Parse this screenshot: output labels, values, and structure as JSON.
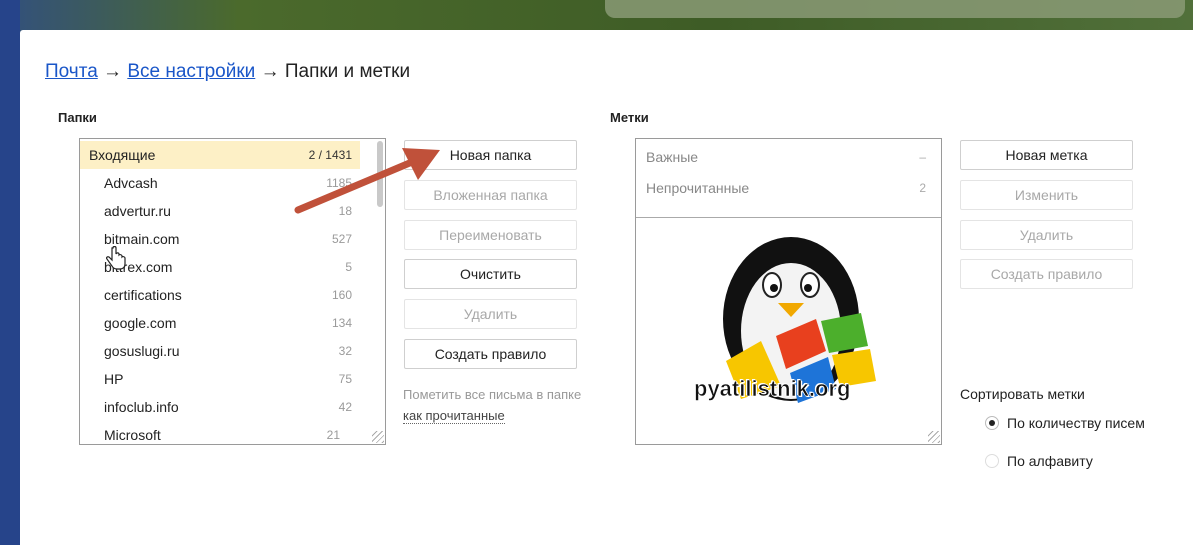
{
  "breadcrumb": {
    "mail": "Почта",
    "sep1": "→",
    "settings": "Все настройки",
    "sep2": "→",
    "current": "Папки и метки"
  },
  "folders": {
    "title": "Папки",
    "items": [
      {
        "name": "Входящие",
        "count": "2 / 1431"
      },
      {
        "name": "Advcash",
        "count": "1185"
      },
      {
        "name": "advertur.ru",
        "count": "18"
      },
      {
        "name": "bitmain.com",
        "count": "527"
      },
      {
        "name": "bittrex.com",
        "count": "5"
      },
      {
        "name": "certifications",
        "count": "160"
      },
      {
        "name": "google.com",
        "count": "134"
      },
      {
        "name": "gosuslugi.ru",
        "count": "32"
      },
      {
        "name": "HP",
        "count": "75"
      },
      {
        "name": "infoclub.info",
        "count": "42"
      },
      {
        "name": "Microsoft",
        "count": "21"
      }
    ]
  },
  "folder_actions": {
    "new_folder": "Новая папка",
    "subfolder": "Вложенная папка",
    "rename": "Переименовать",
    "clear": "Очистить",
    "delete": "Удалить",
    "create_rule": "Создать правило",
    "mark_read_text": "Пометить все письма в папке",
    "mark_read_link": "как прочитанные"
  },
  "labels": {
    "title": "Метки",
    "items": [
      {
        "name": "Важные",
        "count": "–"
      },
      {
        "name": "Непрочитанные",
        "count": "2"
      }
    ],
    "watermark_text": "pyatilistnik.org"
  },
  "label_actions": {
    "new_label": "Новая метка",
    "edit": "Изменить",
    "delete": "Удалить",
    "create_rule": "Создать правило"
  },
  "sort": {
    "title": "Сортировать метки",
    "by_count": "По количеству писем",
    "by_alpha": "По алфавиту"
  },
  "colors": {
    "link": "#1a56c8",
    "selected_row": "#fdf0c6",
    "annotation_arrow": "#c0513a"
  }
}
